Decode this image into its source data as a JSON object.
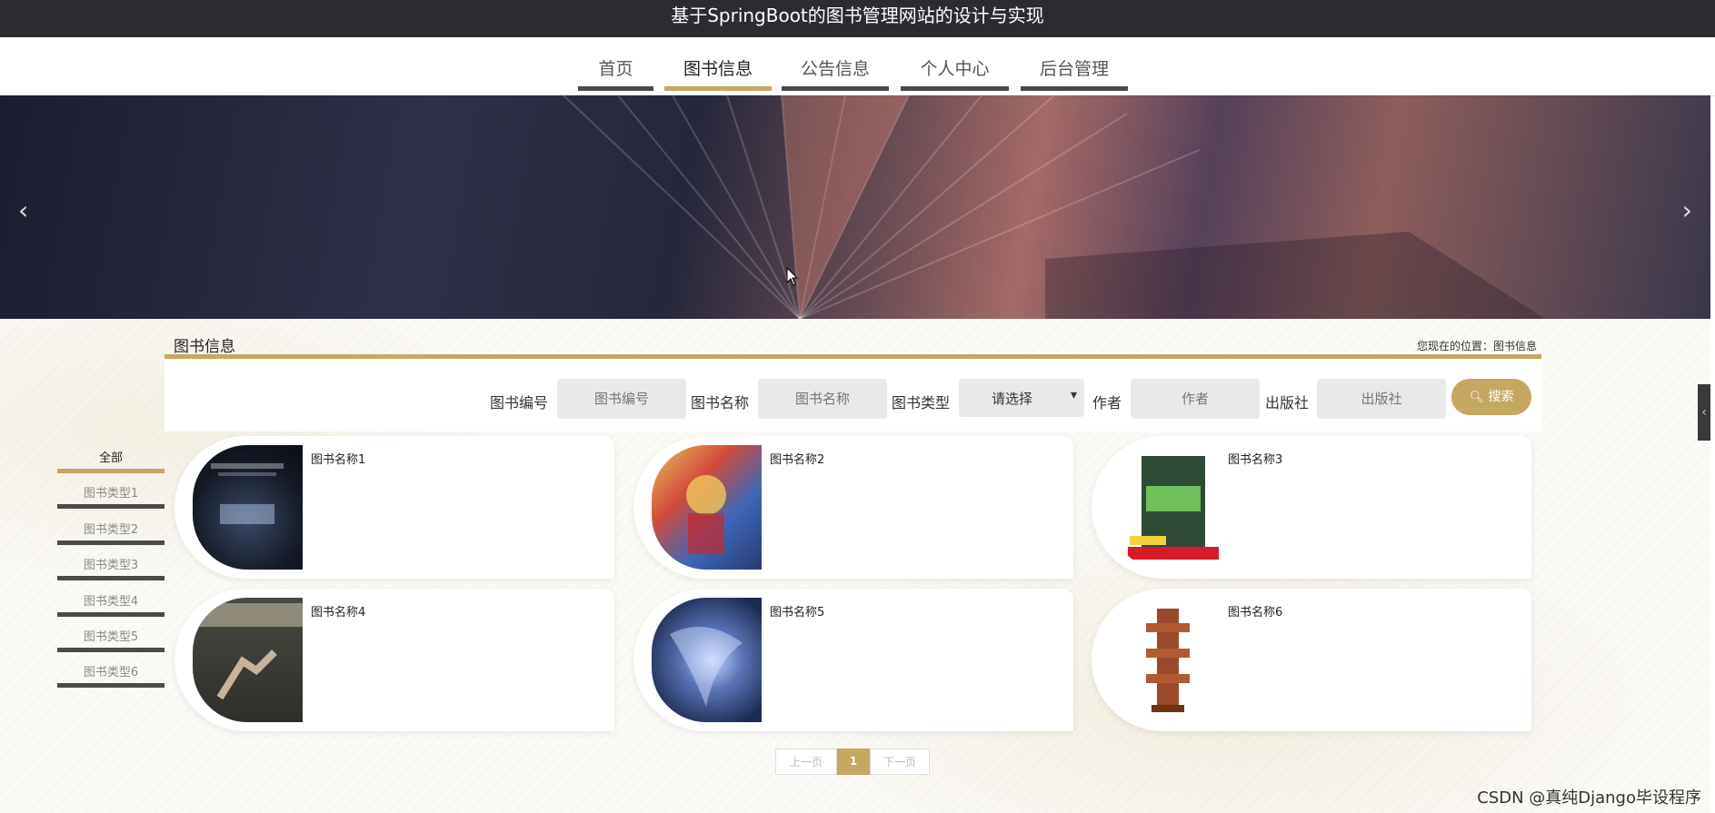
{
  "header": {
    "title": "基于SpringBoot的图书管理网站的设计与实现"
  },
  "nav": {
    "items": [
      {
        "label": "首页",
        "active": false
      },
      {
        "label": "图书信息",
        "active": true
      },
      {
        "label": "公告信息",
        "active": false
      },
      {
        "label": "个人中心",
        "active": false
      },
      {
        "label": "后台管理",
        "active": false
      }
    ]
  },
  "banner": {
    "prev_icon": "chevron-left-icon",
    "next_icon": "chevron-right-icon"
  },
  "section": {
    "title": "图书信息",
    "breadcrumb": "您现在的位置：图书信息"
  },
  "search": {
    "fields": [
      {
        "label": "图书编号",
        "placeholder": "图书编号"
      },
      {
        "label": "图书名称",
        "placeholder": "图书名称"
      },
      {
        "label": "图书类型",
        "value": "请选择"
      },
      {
        "label": "作者",
        "placeholder": "作者"
      },
      {
        "label": "出版社",
        "placeholder": "出版社"
      }
    ],
    "button_label": "搜索"
  },
  "categories": [
    {
      "label": "全部",
      "active": true
    },
    {
      "label": "图书类型1",
      "active": false
    },
    {
      "label": "图书类型2",
      "active": false
    },
    {
      "label": "图书类型3",
      "active": false
    },
    {
      "label": "图书类型4",
      "active": false
    },
    {
      "label": "图书类型5",
      "active": false
    },
    {
      "label": "图书类型6",
      "active": false
    }
  ],
  "books": [
    {
      "name": "图书名称1"
    },
    {
      "name": "图书名称2"
    },
    {
      "name": "图书名称3"
    },
    {
      "name": "图书名称4"
    },
    {
      "name": "图书名称5"
    },
    {
      "name": "图书名称6"
    }
  ],
  "pagination": {
    "prev": "上一页",
    "current": "1",
    "next": "下一页"
  },
  "watermark": "CSDN @真纯Django毕设程序",
  "colors": {
    "accent": "#c6a760",
    "topbar": "#2a2c31",
    "nav_underline": "#4a4a4a"
  }
}
